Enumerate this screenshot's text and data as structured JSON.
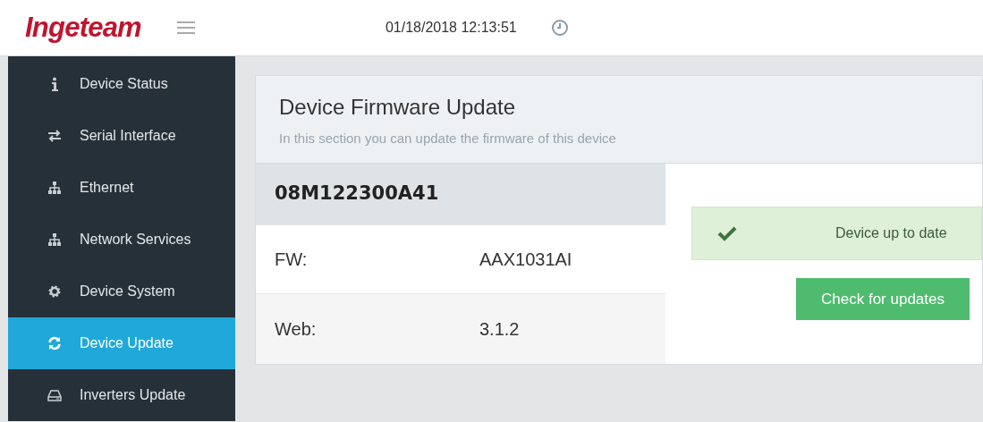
{
  "header": {
    "logo": "Ingeteam",
    "datetime": "01/18/2018 12:13:51"
  },
  "sidebar": {
    "items": [
      {
        "label": "Device Status",
        "selected": false
      },
      {
        "label": "Serial Interface",
        "selected": false
      },
      {
        "label": "Ethernet",
        "selected": false
      },
      {
        "label": "Network Services",
        "selected": false
      },
      {
        "label": "Device System",
        "selected": false
      },
      {
        "label": "Device Update",
        "selected": true
      },
      {
        "label": "Inverters Update",
        "selected": false
      }
    ]
  },
  "panel": {
    "title": "Device Firmware Update",
    "subtitle": "In this section you can update the firmware of this device",
    "device_id": "08M122300A41",
    "rows": [
      {
        "label": "FW:",
        "value": "AAX1031AI"
      },
      {
        "label": "Web:",
        "value": "3.1.2"
      }
    ],
    "status": "Device up to date",
    "button": "Check for updates"
  }
}
